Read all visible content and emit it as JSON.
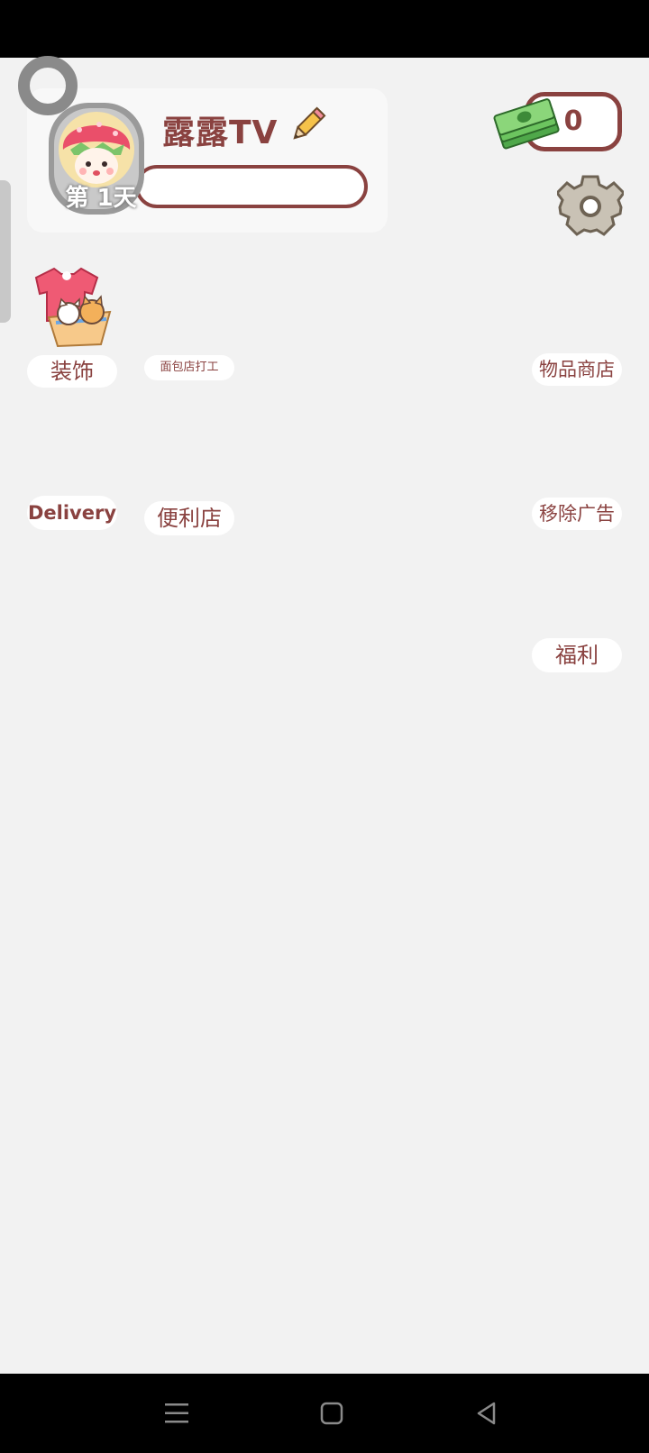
{
  "profile": {
    "name": "露露TV",
    "day_badge": "第 1天"
  },
  "currency": {
    "money": "0"
  },
  "menu": {
    "decor": "装饰",
    "bakery_job": "面包店打工",
    "item_shop": "物品商店",
    "delivery": "Delivery",
    "convenience_store": "便利店",
    "remove_ads": "移除广告",
    "welfare": "福利"
  },
  "colors": {
    "accent": "#8a4240",
    "background": "#f2f2f2",
    "pill": "#ffffff"
  },
  "icons": [
    "ring-icon",
    "avatar-strawberry-girl",
    "pencil-icon",
    "cash-icon",
    "gear-icon",
    "decor-shirt-cats-icon",
    "menu-icon",
    "home-icon",
    "back-icon"
  ]
}
